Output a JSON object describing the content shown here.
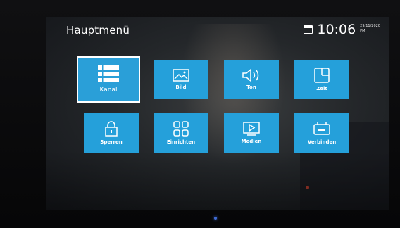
{
  "header": {
    "title": "Hauptmenü",
    "time": "10:06",
    "date_small": "29/11/2020",
    "date_sub": "PM"
  },
  "menu": {
    "items": [
      {
        "label": "Kanal",
        "icon": "list-icon",
        "selected": true
      },
      {
        "label": "Bild",
        "icon": "picture-icon",
        "selected": false
      },
      {
        "label": "Ton",
        "icon": "speaker-icon",
        "selected": false
      },
      {
        "label": "Zeit",
        "icon": "clock-grid-icon",
        "selected": false
      },
      {
        "label": "Sperren",
        "icon": "lock-icon",
        "selected": false
      },
      {
        "label": "Einrichten",
        "icon": "grid-icon",
        "selected": false
      },
      {
        "label": "Medien",
        "icon": "media-play-icon",
        "selected": false
      },
      {
        "label": "Verbinden",
        "icon": "connect-icon",
        "selected": false
      }
    ]
  },
  "colors": {
    "tile": "#25a0da",
    "tile_border_selected": "#ffffff",
    "text": "#ffffff"
  }
}
